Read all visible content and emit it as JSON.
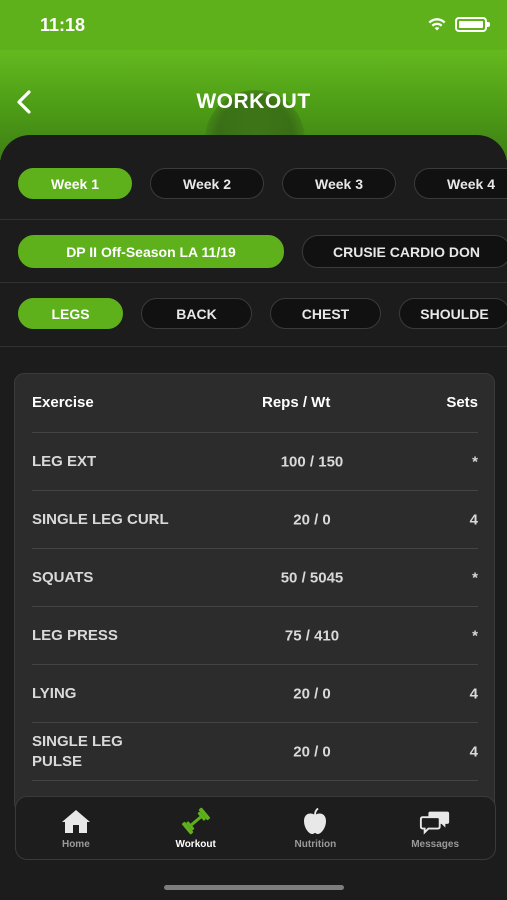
{
  "status_bar": {
    "time": "11:18"
  },
  "header": {
    "title": "WORKOUT"
  },
  "weeks": [
    {
      "label": "Week 1",
      "active": true
    },
    {
      "label": "Week 2",
      "active": false
    },
    {
      "label": "Week 3",
      "active": false
    },
    {
      "label": "Week 4",
      "active": false
    }
  ],
  "programs": [
    {
      "label": "DP II Off-Season LA 11/19",
      "active": true
    },
    {
      "label": "CRUSIE CARDIO DON",
      "active": false
    }
  ],
  "days": [
    {
      "label": "LEGS",
      "active": true
    },
    {
      "label": "BACK",
      "active": false
    },
    {
      "label": "CHEST",
      "active": false
    },
    {
      "label": "SHOULDE",
      "active": false
    }
  ],
  "table": {
    "headers": {
      "exercise": "Exercise",
      "reps_wt": "Reps  / Wt",
      "sets": "Sets"
    },
    "rows": [
      {
        "name": "LEG EXT",
        "reps_wt": "100  / 150",
        "sets": "*"
      },
      {
        "name": "SINGLE LEG CURL",
        "reps_wt": "20  / 0",
        "sets": "4"
      },
      {
        "name": "SQUATS",
        "reps_wt": "50  / 5045",
        "sets": "*"
      },
      {
        "name": "LEG PRESS",
        "reps_wt": "75  / 410",
        "sets": "*"
      },
      {
        "name": "LYING",
        "reps_wt": "20  / 0",
        "sets": "4"
      },
      {
        "name": "SINGLE LEG PULSE",
        "reps_wt": "20  / 0",
        "sets": "4"
      }
    ]
  },
  "tabs": [
    {
      "label": "Home",
      "icon": "home-icon",
      "active": false
    },
    {
      "label": "Workout",
      "icon": "dumbbell-icon",
      "active": true
    },
    {
      "label": "Nutrition",
      "icon": "apple-icon",
      "active": false
    },
    {
      "label": "Messages",
      "icon": "chat-bubbles-icon",
      "active": false
    }
  ],
  "colors": {
    "accent": "#5fb11c",
    "background": "#1c1c1c",
    "card": "#2c2c2c"
  }
}
